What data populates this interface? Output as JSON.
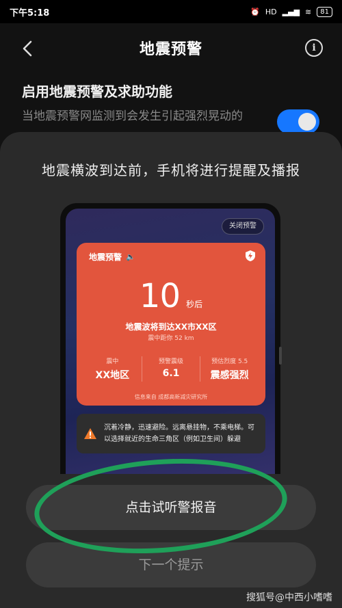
{
  "status_bar": {
    "time": "下午5:18",
    "network": "HD",
    "battery": "81"
  },
  "header": {
    "title": "地震预警"
  },
  "setting": {
    "title": "启用地震预警及求助功能",
    "description": "当地震预警网监测到会发生引起强烈晃动的",
    "enabled": true
  },
  "sheet": {
    "heading": "地震横波到达前，手机将进行提醒及播报",
    "preview": {
      "close_button": "关闭预警",
      "card_title": "地震预警",
      "countdown": "10",
      "countdown_unit": "秒后",
      "arrival": "地震波将到达XX市XX区",
      "distance": "震中距你 52 km",
      "stats": [
        {
          "label": "震中",
          "value": "XX地区"
        },
        {
          "label": "预警震级",
          "value": "6.1"
        },
        {
          "label": "预估烈度 5.5",
          "value": "震感强烈"
        }
      ],
      "source": "信息来自 成都高新减灾研究所",
      "tip": "沉着冷静，迅速避险。远离悬挂物，不乘电梯。可以选择就近的生命三角区（例如卫生间）躲避"
    },
    "play_button": "点击试听警报音",
    "next_button": "下一个提示"
  },
  "watermark": "搜狐号@中西小嗜嗜",
  "colors": {
    "accent": "#1677ff",
    "card": "#e2553d",
    "highlight": "#1fa059"
  }
}
